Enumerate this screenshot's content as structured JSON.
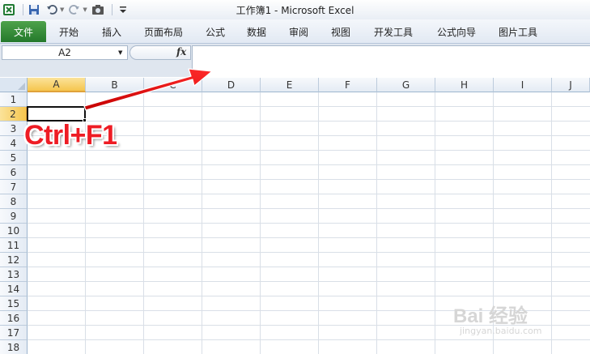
{
  "window": {
    "title": "工作簿1 - Microsoft Excel"
  },
  "quick_access": {
    "icons": [
      "excel-logo-icon",
      "save-icon",
      "undo-icon",
      "redo-icon",
      "camera-icon",
      "customize-icon"
    ]
  },
  "ribbon": {
    "file_tab": "文件",
    "tabs": [
      "开始",
      "插入",
      "页面布局",
      "公式",
      "数据",
      "审阅",
      "视图",
      "开发工具",
      "公式向导",
      "图片工具"
    ]
  },
  "formula_bar": {
    "name_box": "A2",
    "fx_label": "fx",
    "value": ""
  },
  "grid": {
    "columns": [
      "A",
      "B",
      "C",
      "D",
      "E",
      "F",
      "G",
      "H",
      "I",
      "J"
    ],
    "rows": [
      "1",
      "2",
      "3",
      "4",
      "5",
      "6",
      "7",
      "8",
      "9",
      "10",
      "11",
      "12",
      "13",
      "14",
      "15",
      "16",
      "17",
      "18"
    ],
    "active_column": "A",
    "active_row": "2",
    "active_cell": "A2"
  },
  "annotation": {
    "text": "Ctrl+F1",
    "color": "#ee1c24"
  },
  "watermark": {
    "brand": "Bai 经验",
    "url": "jingyan.baidu.com"
  },
  "colors": {
    "file_tab": "#24792b",
    "active_header": "#f5c54e",
    "accent_red": "#ee1c24"
  }
}
